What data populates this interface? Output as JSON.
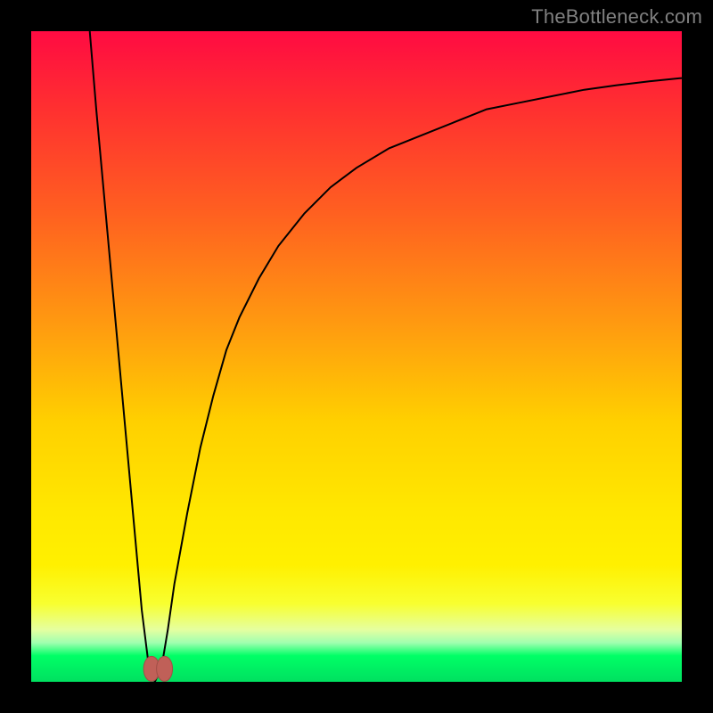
{
  "watermark": "TheBottleneck.com",
  "colors": {
    "frame": "#000000",
    "curve": "#000000",
    "marker": "#c06058",
    "gradient_top": "#ff0b42",
    "gradient_bottom": "#00e060"
  },
  "chart_data": {
    "type": "line",
    "title": "",
    "xlabel": "",
    "ylabel": "",
    "xlim": [
      0,
      100
    ],
    "ylim": [
      0,
      100
    ],
    "x": [
      9,
      10,
      11,
      12,
      13,
      14,
      15,
      16,
      17,
      18,
      19,
      20,
      21,
      22,
      24,
      26,
      28,
      30,
      32,
      35,
      38,
      42,
      46,
      50,
      55,
      60,
      65,
      70,
      75,
      80,
      85,
      90,
      95,
      100
    ],
    "values": [
      100,
      88,
      77,
      66,
      55,
      44,
      33,
      22,
      11,
      3,
      0,
      2,
      8,
      15,
      26,
      36,
      44,
      51,
      56,
      62,
      67,
      72,
      76,
      79,
      82,
      84,
      86,
      88,
      89,
      90,
      91,
      91.7,
      92.3,
      92.8
    ],
    "markers": {
      "x": [
        18.5,
        20.5
      ],
      "y": [
        2,
        2
      ]
    },
    "annotations": []
  }
}
